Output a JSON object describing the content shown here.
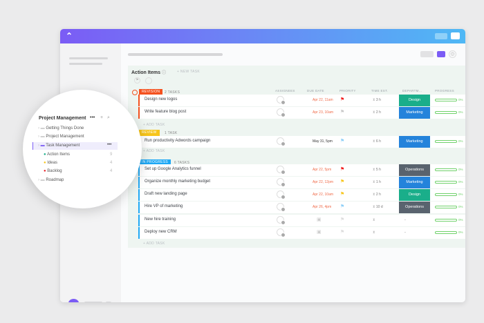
{
  "header": {
    "logo": "ClickUp"
  },
  "list": {
    "title": "Action Items",
    "new_task": "+ NEW TASK",
    "add_task": "+ ADD TASK",
    "columns": [
      "ASSIGNEES",
      "DUE DATE",
      "PRIORITY",
      "TIME EST.",
      "DEPARTM...",
      "PROGRESS"
    ]
  },
  "groups": [
    {
      "status": "REVISION",
      "count": "2 TASKS",
      "color": "#f4511e",
      "tasks": [
        {
          "name": "Design new logos",
          "due": "Apr 22, 11am",
          "priority": "#f21b1b",
          "time": "3 h",
          "dept": "Design",
          "dept_color": "#1aae8a",
          "progress": "0%"
        },
        {
          "name": "Write feature blog post",
          "due": "Apr 23, 10am",
          "priority": "#c8c8c8",
          "time": "2 h",
          "dept": "Marketing",
          "dept_color": "#2483db",
          "progress": "0%"
        }
      ]
    },
    {
      "status": "REVIEW",
      "count": "1 TASK",
      "color": "#f7c51b",
      "tasks": [
        {
          "name": "Run productivity Adwords campaign",
          "due": "May 31, 5pm",
          "due_dark": true,
          "priority": "#8fd0f8",
          "time": "6 h",
          "dept": "Marketing",
          "dept_color": "#2483db",
          "progress": "0%"
        }
      ]
    },
    {
      "status": "IN PROGRESS",
      "count": "6 TASKS",
      "color": "#1ea8f5",
      "tasks": [
        {
          "name": "Set up Google Analytics funnel",
          "due": "Apr 22, 5pm",
          "priority": "#f21b1b",
          "time": "5 h",
          "dept": "Operations",
          "dept_color": "#59636e",
          "progress": "0%"
        },
        {
          "name": "Organize monthly marketing budget",
          "due": "Apr 22, 12pm",
          "priority": "#f7c51b",
          "time": "1 h",
          "dept": "Marketing",
          "dept_color": "#2483db",
          "progress": "0%"
        },
        {
          "name": "Draft new landing page",
          "due": "Apr 22, 10am",
          "priority": "#f7c51b",
          "time": "2 h",
          "dept": "Design",
          "dept_color": "#1aae8a",
          "progress": "0%"
        },
        {
          "name": "Hire VP of marketing",
          "due": "Apr 26, 4pm",
          "priority": "#8fd0f8",
          "time": "10 d",
          "dept": "Operations",
          "dept_color": "#59636e",
          "progress": "0%"
        },
        {
          "name": "New hire training",
          "due": "",
          "priority": "",
          "time": "",
          "dept": "-",
          "dept_color": "",
          "progress": "0%"
        },
        {
          "name": "Deploy new CRM",
          "due": "",
          "priority": "",
          "time": "",
          "dept": "-",
          "dept_color": "",
          "progress": "0%"
        }
      ]
    }
  ],
  "sidebar_popup": {
    "title": "Project Management",
    "items": [
      {
        "label": "Getting Things Done"
      },
      {
        "label": "Project Management"
      },
      {
        "label": "Task Management",
        "active": true
      }
    ],
    "lists": [
      {
        "label": "Action Items",
        "count": "9",
        "color": "#1aae8a"
      },
      {
        "label": "Ideas",
        "count": "4",
        "color": "#f7c51b"
      },
      {
        "label": "Backlog",
        "count": "4",
        "color": "#e8252b"
      }
    ],
    "roadmap": "Roadmap"
  }
}
